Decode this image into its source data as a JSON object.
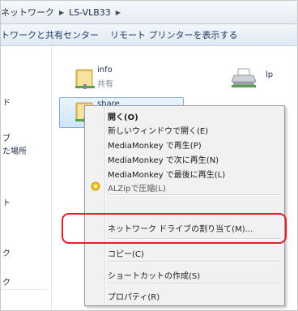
{
  "address_bar": {
    "crumbs": [
      "ネットワーク",
      "LS-VLB33"
    ]
  },
  "command_bar": {
    "network_center": "トワークと共有センター",
    "remote_printers": "リモート プリンターを表示する"
  },
  "nav_pane": {
    "items": [
      "ド",
      "ブ",
      "た場所",
      "ト",
      "ク",
      "ク"
    ]
  },
  "items": [
    {
      "name": "info",
      "sub": "共有",
      "icon": "folder-icon"
    },
    {
      "name": "share",
      "sub": "共有",
      "icon": "folder-icon",
      "selected": true
    },
    {
      "name": "lp",
      "icon": "printer-icon"
    }
  ],
  "context_menu": {
    "items": [
      {
        "label": "開く(O)",
        "bold": true
      },
      {
        "label": "新しいウィンドウで開く(E)"
      },
      {
        "label": "MediaMonkey で再生(P)"
      },
      {
        "label": "MediaMonkey で次に再生(N)"
      },
      {
        "label": "MediaMonkey で最後に再生(L)"
      },
      {
        "label": "ALZipで圧縮(L)",
        "icon": "alzip-icon"
      },
      {
        "label": "ネットワーク ドライブの割り当て(M)...",
        "highlighted": true
      },
      {
        "label": "コピー(C)"
      },
      {
        "label": "ショートカットの作成(S)"
      },
      {
        "label": "プロパティ(R)"
      }
    ]
  },
  "colors": {
    "highlight_border": "#e0202a",
    "selection_fill": "#cfe5fa",
    "menu_background": "#f1f1f1"
  }
}
